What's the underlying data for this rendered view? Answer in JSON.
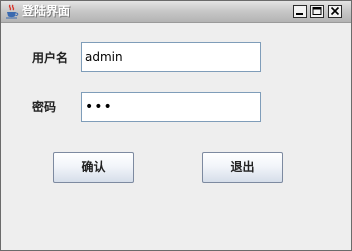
{
  "window": {
    "title": "登陆界面",
    "icon": "java-coffee-cup-icon",
    "controls": {
      "minimize": "minimize-icon",
      "maximize": "maximize-icon",
      "close": "close-icon"
    }
  },
  "form": {
    "username_label": "用户名",
    "username_value": "admin",
    "password_label": "密码",
    "password_mask": "•••"
  },
  "buttons": {
    "confirm_label": "确认",
    "exit_label": "退出"
  },
  "colors": {
    "window_background": "#eeeeee",
    "field_border": "#7f9db9"
  }
}
